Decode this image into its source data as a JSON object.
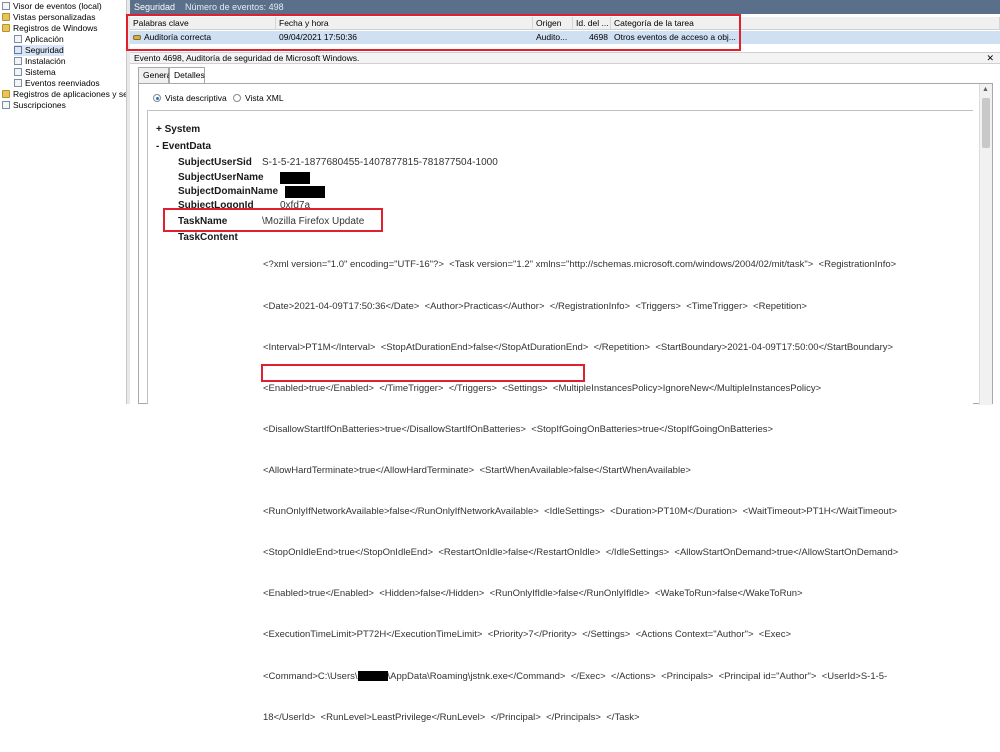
{
  "tree": {
    "items": [
      {
        "label": "Visor de eventos (local)",
        "icon": "computer-icon",
        "indent": 0
      },
      {
        "label": "Vistas personalizadas",
        "icon": "folder-icon",
        "indent": 1
      },
      {
        "label": "Registros de Windows",
        "icon": "folder-icon",
        "indent": 1
      },
      {
        "label": "Aplicación",
        "icon": "log-icon",
        "indent": 2
      },
      {
        "label": "Seguridad",
        "icon": "log-icon",
        "indent": 2,
        "selected": true
      },
      {
        "label": "Instalación",
        "icon": "log-icon",
        "indent": 2
      },
      {
        "label": "Sistema",
        "icon": "log-icon",
        "indent": 2
      },
      {
        "label": "Eventos reenviados",
        "icon": "log-icon",
        "indent": 2
      },
      {
        "label": "Registros de aplicaciones y serv",
        "icon": "folder-icon",
        "indent": 1
      },
      {
        "label": "Suscripciones",
        "icon": "log-icon",
        "indent": 1
      }
    ]
  },
  "header": {
    "title": "Seguridad",
    "count": "Número de eventos: 498"
  },
  "grid": {
    "columns": [
      "Palabras clave",
      "Fecha y hora",
      "Origen",
      "Id. del ...",
      "Categoría de la tarea"
    ],
    "row": [
      "Auditoría correcta",
      "09/04/2021 17:50:36",
      "Audito...",
      "4698",
      "Otros eventos de acceso a obj..."
    ]
  },
  "event": {
    "title": "Evento 4698, Auditoría de seguridad de Microsoft Windows.",
    "close": "✕"
  },
  "tabs": [
    "General",
    "Detalles"
  ],
  "radios": {
    "friendly": "Vista descriptiva",
    "xml": "Vista XML"
  },
  "details": {
    "system": "+  System",
    "eventdata": "-  EventData",
    "fields": [
      {
        "name": "SubjectUserSid",
        "value": "S-1-5-21-1877680455-1407877815-781877504-1000"
      },
      {
        "name": "SubjectUserName",
        "value": ""
      },
      {
        "name": "SubjectDomainName",
        "value": ""
      },
      {
        "name": "SubjectLogonId",
        "value": "0xfd7a"
      },
      {
        "name": "TaskName",
        "value": "\\Mozilla Firefox Update"
      },
      {
        "name": "TaskContent",
        "value": ""
      }
    ],
    "xml_lines": [
      "<?xml version=\"1.0\" encoding=\"UTF-16\"?>  <Task version=\"1.2\" xmlns=\"http://schemas.microsoft.com/windows/2004/02/mit/task\">  <RegistrationInfo>",
      "<Date>2021-04-09T17:50:36</Date>  <Author>Practicas</Author>  </RegistrationInfo>  <Triggers>  <TimeTrigger>  <Repetition>",
      "<Interval>PT1M</Interval>  <StopAtDurationEnd>false</StopAtDurationEnd>  </Repetition>  <StartBoundary>2021-04-09T17:50:00</StartBoundary>",
      "<Enabled>true</Enabled>  </TimeTrigger>  </Triggers>  <Settings>  <MultipleInstancesPolicy>IgnoreNew</MultipleInstancesPolicy>",
      "<DisallowStartIfOnBatteries>true</DisallowStartIfOnBatteries>  <StopIfGoingOnBatteries>true</StopIfGoingOnBatteries>",
      "<AllowHardTerminate>true</AllowHardTerminate>  <StartWhenAvailable>false</StartWhenAvailable>",
      "<RunOnlyIfNetworkAvailable>false</RunOnlyIfNetworkAvailable>  <IdleSettings>  <Duration>PT10M</Duration>  <WaitTimeout>PT1H</WaitTimeout>",
      "<StopOnIdleEnd>true</StopOnIdleEnd>  <RestartOnIdle>false</RestartOnIdle>  </IdleSettings>  <AllowStartOnDemand>true</AllowStartOnDemand>",
      "<Enabled>true</Enabled>  <Hidden>false</Hidden>  <RunOnlyIfIdle>false</RunOnlyIfIdle>  <WakeToRun>false</WakeToRun>",
      "<ExecutionTimeLimit>PT72H</ExecutionTimeLimit>  <Priority>7</Priority>  </Settings>  <Actions Context=\"Author\">  <Exec>"
    ],
    "cmd_before": "<Command>C:\\Users\\",
    "cmd_after": "\\AppData\\Roaming\\jstnk.exe</Command>",
    "cmd_tail": "  </Exec>  </Actions>  <Principals>  <Principal id=\"Author\">  <UserId>S-1-5-",
    "last_line": "18</UserId>  <RunLevel>LeastPrivilege</RunLevel>  </Principal>  </Principals>  </Task>"
  }
}
